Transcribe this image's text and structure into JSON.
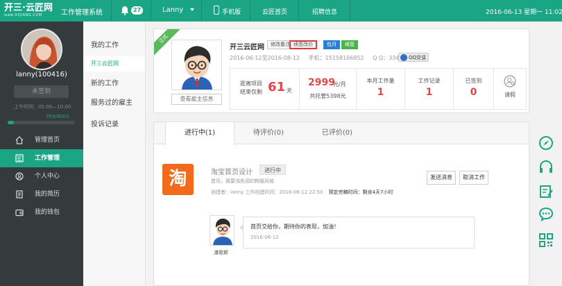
{
  "topbar": {
    "logo_text": "开三·云匠网",
    "logo_sub": "www.93JIANG.COM",
    "system_title": "工作管理系统",
    "notification_count": "27",
    "user_menu": "Lanny",
    "mobile_label": "手机版",
    "link_home": "云匠首页",
    "link_jobs": "招聘信息",
    "date_text": "2016-06-13 星期一 11:02"
  },
  "sidebar": {
    "username": "lanny(100416)",
    "signin_label": "未签到",
    "work_time": "上午时间：05:00—10:00",
    "progress_text": "359/4000",
    "progress_value": 0.09,
    "nav": [
      {
        "label": "管理首页",
        "icon": "home-icon"
      },
      {
        "label": "工作管理",
        "icon": "work-manage-icon"
      },
      {
        "label": "个人中心",
        "icon": "user-icon"
      },
      {
        "label": "我的简历",
        "icon": "resume-icon"
      },
      {
        "label": "我的钱包",
        "icon": "wallet-icon"
      }
    ],
    "active_nav": 1
  },
  "submenu": {
    "items": [
      "我的工作",
      "开三云匠网",
      "新的工作",
      "服务过的雇主",
      "投诉记录"
    ],
    "active": 1
  },
  "employer": {
    "ribbon": "正式",
    "name": "开三云匠网",
    "tags": [
      "修改备注",
      "续签改价",
      "包月",
      "续签"
    ],
    "period": "2016-06-12至2016-08-12",
    "phone": "手机：15158166852",
    "qq": "Q Q：3340994903",
    "qq_button": "QQ交谈",
    "view_button": "查看雇主信息",
    "stats": {
      "remaining_label1": "距离项目",
      "remaining_label2": "结束仅剩",
      "remaining_value": "61",
      "remaining_unit": "天",
      "price_value": "2999",
      "price_unit": "元/月",
      "price_total": "共托管5398元",
      "workload_label": "本月工作量",
      "workload_value": "1",
      "records_label": "工作记录",
      "records_value": "1",
      "signed_label": "已签到",
      "signed_value": "0",
      "leave_label": "请假"
    }
  },
  "tabs": [
    "进行中(1)",
    "待评价(0)",
    "已评价(0)"
  ],
  "task": {
    "icon_char": "淘",
    "title": "淘宝首页设计",
    "status": "进行中",
    "desc": "首页，我要浅色调的韩版风格",
    "meta": "创建者：lanny 工作创建时间：2016-06-12 22:50",
    "deadline": "预定完稿时间：剩余4天7小时",
    "btn_send": "发送消息",
    "btn_cancel": "取消工作"
  },
  "comment": {
    "name": "潘歌斯",
    "text": "首页交给你，期待你的表现，加油！",
    "date": "2016-06-12"
  },
  "colors": {
    "brand": "#1aa585",
    "sidebar": "#353a3d",
    "accent_red": "#e4454b"
  }
}
